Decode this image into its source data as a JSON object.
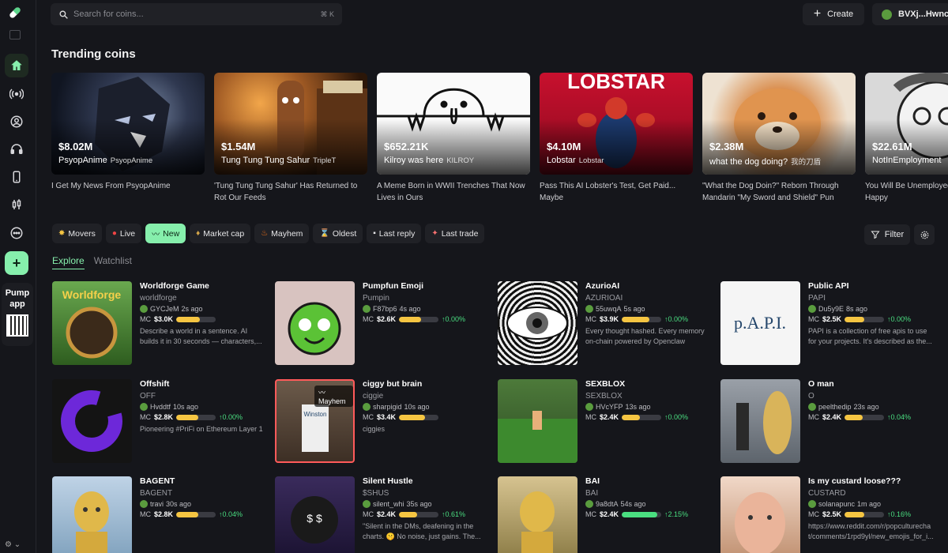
{
  "search": {
    "placeholder": "Search for coins...",
    "shortcut": "⌘  K"
  },
  "header": {
    "create_label": "Create",
    "wallet_label": "BVXj...Hwnc"
  },
  "sidebar": {
    "pump_app_line1": "Pump",
    "pump_app_line2": "app"
  },
  "trending": {
    "title": "Trending coins",
    "items": [
      {
        "mc": "$8.02M",
        "name": "PsyopAnime",
        "ticker": "PsyopAnime",
        "desc": "I Get My News From PsyopAnime"
      },
      {
        "mc": "$1.54M",
        "name": "Tung Tung Tung Sahur",
        "ticker": "TripleT",
        "desc": "'Tung Tung Tung Sahur' Has Returned to Rot Our Feeds"
      },
      {
        "mc": "$652.21K",
        "name": "Kilroy was here",
        "ticker": "KILROY",
        "desc": "A Meme Born in WWII Trenches That Now Lives in Ours"
      },
      {
        "mc": "$4.10M",
        "name": "Lobstar",
        "ticker": "Lobstar",
        "desc": "Pass This AI Lobster's Test, Get Paid... Maybe"
      },
      {
        "mc": "$2.38M",
        "name": "what the dog doing?",
        "ticker": "我的刀盾",
        "desc": "\"What the Dog Doin?\" Reborn Through Mandarin \"My Sword and Shield\" Pun"
      },
      {
        "mc": "$22.61M",
        "name": "NotInEmployment",
        "ticker": "",
        "desc": "You Will Be Unemployed and You Will Be Happy"
      }
    ]
  },
  "filters": [
    {
      "icon": "✸",
      "label": "Movers"
    },
    {
      "icon": "●",
      "label": "Live"
    },
    {
      "icon": "〰",
      "label": "New"
    },
    {
      "icon": "♦",
      "label": "Market cap"
    },
    {
      "icon": "♨",
      "label": "Mayhem"
    },
    {
      "icon": "⌛",
      "label": "Oldest"
    },
    {
      "icon": "▪",
      "label": "Last reply"
    },
    {
      "icon": "✦",
      "label": "Last trade"
    }
  ],
  "filter_label": "Filter",
  "tabs": {
    "explore": "Explore",
    "watchlist": "Watchlist"
  },
  "coins": [
    {
      "title": "Worldforge Game",
      "ticker": "worldforge",
      "user": "GYCJeM",
      "age": "2s ago",
      "mc": "$3.0K",
      "pct": "",
      "fill": 0.6,
      "desc": "Describe a world in a sentence. AI builds it in 30 seconds — characters,..."
    },
    {
      "title": "Pumpfun Emoji",
      "ticker": "Pumpin",
      "user": "F87bp6",
      "age": "4s ago",
      "mc": "$2.6K",
      "pct": "↑0.00%",
      "fill": 0.55,
      "desc": ""
    },
    {
      "title": "AzurioAI",
      "ticker": "AZURIOAI",
      "user": "55uwqA",
      "age": "5s ago",
      "mc": "$3.9K",
      "pct": "↑0.00%",
      "fill": 0.7,
      "desc": "Every thought hashed. Every memory on-chain powered by Openclaw"
    },
    {
      "title": "Public API",
      "ticker": "PAPI",
      "user": "Du5y9E",
      "age": "8s ago",
      "mc": "$2.5K",
      "pct": "↑0.00%",
      "fill": 0.5,
      "desc": "PAPI is a collection of free apis to use for your projects. It's described as the..."
    },
    {
      "title": "Offshift",
      "ticker": "OFF",
      "user": "Hvddtf",
      "age": "10s ago",
      "mc": "$2.8K",
      "pct": "↑0.00%",
      "fill": 0.55,
      "desc": "Pioneering #PriFi on Ethereum Layer 1"
    },
    {
      "title": "ciggy but brain",
      "ticker": "ciggie",
      "user": "sharpigid",
      "age": "10s ago",
      "mc": "$3.4K",
      "pct": "",
      "fill": 0.65,
      "desc": "ciggies",
      "badge": "Mayhem"
    },
    {
      "title": "SEXBLOX",
      "ticker": "SEXBLOX",
      "user": "HVcYFP",
      "age": "13s ago",
      "mc": "$2.4K",
      "pct": "↑0.00%",
      "fill": 0.45,
      "desc": ""
    },
    {
      "title": "O man",
      "ticker": "O",
      "user": "peelthedip",
      "age": "23s ago",
      "mc": "$2.4K",
      "pct": "↑0.04%",
      "fill": 0.45,
      "desc": ""
    },
    {
      "title": "BAGENT",
      "ticker": "BAGENT",
      "user": "travi",
      "age": "30s ago",
      "mc": "$2.8K",
      "pct": "↑0.04%",
      "fill": 0.55,
      "desc": ""
    },
    {
      "title": "Silent Hustle",
      "ticker": "$SHUS",
      "user": "silent_whi",
      "age": "35s ago",
      "mc": "$2.4K",
      "pct": "↑0.61%",
      "fill": 0.45,
      "desc": "\"Silent in the DMs, deafening in the charts. 🤫 No noise, just gains. The..."
    },
    {
      "title": "BAI",
      "ticker": "BAI",
      "user": "9a8dtA",
      "age": "54s ago",
      "mc": "$2.4K",
      "pct": "↑2.15%",
      "fill": 0.9,
      "green": true,
      "desc": ""
    },
    {
      "title": "Is my custard loose???",
      "ticker": "CUSTARD",
      "user": "solanapunc",
      "age": "1m ago",
      "mc": "$2.5K",
      "pct": "↑0.16%",
      "fill": 0.5,
      "desc": "https://www.reddit.com/r/popculturecha t/comments/1rpd9yl/new_emojis_for_i..."
    }
  ],
  "colors": {
    "accent": "#86efac",
    "bg": "#15161b",
    "panel": "#202126",
    "progress": "#f5c542",
    "highlight": "#ff5a5a"
  }
}
